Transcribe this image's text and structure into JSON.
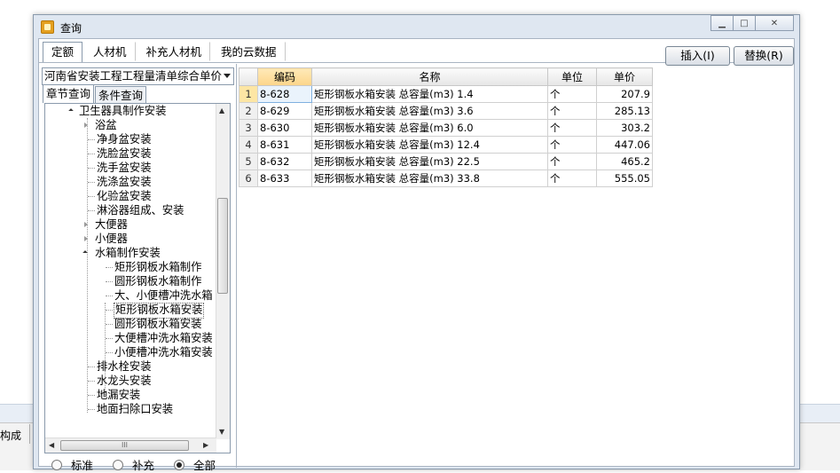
{
  "background": {
    "status_label": "构成"
  },
  "window": {
    "title": "查询",
    "min_icon": "minimize-icon",
    "max_icon": "maximize-icon",
    "close_icon": "close-icon"
  },
  "tabs": [
    {
      "label": "定额",
      "active": true
    },
    {
      "label": "人材机",
      "active": false
    },
    {
      "label": "补充人材机",
      "active": false
    },
    {
      "label": "我的云数据",
      "active": false
    }
  ],
  "actions": {
    "insert": "插入(I)",
    "replace": "替换(R)"
  },
  "library": {
    "selected": "河南省安装工程工程量清单综合单价"
  },
  "subtabs": [
    {
      "label": "章节查询",
      "active": true
    },
    {
      "label": "条件查询",
      "active": false
    }
  ],
  "tree": [
    {
      "label": "卫生器具制作安装",
      "state": "open"
    },
    {
      "label": "浴盆",
      "state": "closed"
    },
    {
      "label": "净身盆安装",
      "state": "leaf"
    },
    {
      "label": "洗脸盆安装",
      "state": "leaf"
    },
    {
      "label": "洗手盆安装",
      "state": "leaf"
    },
    {
      "label": "洗涤盆安装",
      "state": "leaf"
    },
    {
      "label": "化验盆安装",
      "state": "leaf"
    },
    {
      "label": "淋浴器组成、安装",
      "state": "leaf"
    },
    {
      "label": "大便器",
      "state": "closed"
    },
    {
      "label": "小便器",
      "state": "closed"
    },
    {
      "label": "水箱制作安装",
      "state": "open"
    },
    {
      "label": "矩形钢板水箱制作",
      "state": "leaf"
    },
    {
      "label": "圆形钢板水箱制作",
      "state": "leaf"
    },
    {
      "label": "大、小便槽冲洗水箱",
      "state": "leaf"
    },
    {
      "label": "矩形钢板水箱安装",
      "state": "leaf",
      "selected": true
    },
    {
      "label": "圆形钢板水箱安装",
      "state": "leaf"
    },
    {
      "label": "大便槽冲洗水箱安装",
      "state": "leaf"
    },
    {
      "label": "小便槽冲洗水箱安装",
      "state": "leaf"
    },
    {
      "label": "排水栓安装",
      "state": "leaf"
    },
    {
      "label": "水龙头安装",
      "state": "leaf"
    },
    {
      "label": "地漏安装",
      "state": "leaf"
    },
    {
      "label": "地面扫除口安装",
      "state": "leaf"
    }
  ],
  "scrollbar": {
    "hthumb_label": "III"
  },
  "filter": [
    {
      "label": "标准",
      "checked": false
    },
    {
      "label": "补充",
      "checked": false
    },
    {
      "label": "全部",
      "checked": true
    }
  ],
  "table": {
    "headers": [
      "编码",
      "名称",
      "单位",
      "单价"
    ],
    "rows": [
      {
        "no": "1",
        "code": "8-628",
        "name": "矩形钢板水箱安装 总容量(m3) 1.4",
        "unit": "个",
        "price": "207.9"
      },
      {
        "no": "2",
        "code": "8-629",
        "name": "矩形钢板水箱安装 总容量(m3) 3.6",
        "unit": "个",
        "price": "285.13"
      },
      {
        "no": "3",
        "code": "8-630",
        "name": "矩形钢板水箱安装 总容量(m3) 6.0",
        "unit": "个",
        "price": "303.2"
      },
      {
        "no": "4",
        "code": "8-631",
        "name": "矩形钢板水箱安装 总容量(m3) 12.4",
        "unit": "个",
        "price": "447.06"
      },
      {
        "no": "5",
        "code": "8-632",
        "name": "矩形钢板水箱安装 总容量(m3) 22.5",
        "unit": "个",
        "price": "465.2"
      },
      {
        "no": "6",
        "code": "8-633",
        "name": "矩形钢板水箱安装 总容量(m3) 33.8",
        "unit": "个",
        "price": "555.05"
      }
    ]
  }
}
